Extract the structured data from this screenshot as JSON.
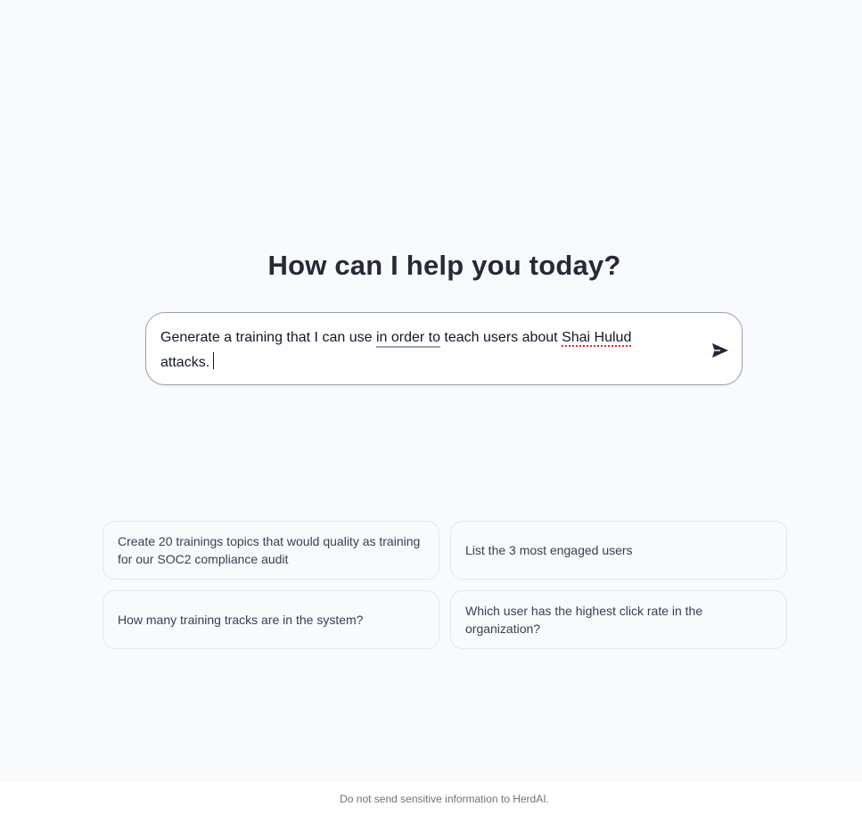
{
  "main": {
    "heading": "How can I help you today?"
  },
  "composer": {
    "text_part1": "Generate a training that I can use ",
    "text_grammar": "in order to",
    "text_part2": " teach users about ",
    "text_spell": "Shai Hulud",
    "text_part3": " attacks.",
    "send_icon": "send-icon"
  },
  "suggestions": [
    {
      "label": "Create 20 trainings topics that would quality as training for our SOC2 compliance audit"
    },
    {
      "label": "List the 3 most engaged users"
    },
    {
      "label": "How many training tracks are in the system?"
    },
    {
      "label": "Which user has the highest click rate in the organization?"
    }
  ],
  "footer": {
    "notice": "Do not send sensitive information to HerdAI."
  },
  "colors": {
    "background": "#f8fafc",
    "heading": "#232b38",
    "spell_error": "#dc2626",
    "border": "#e5e7eb"
  }
}
